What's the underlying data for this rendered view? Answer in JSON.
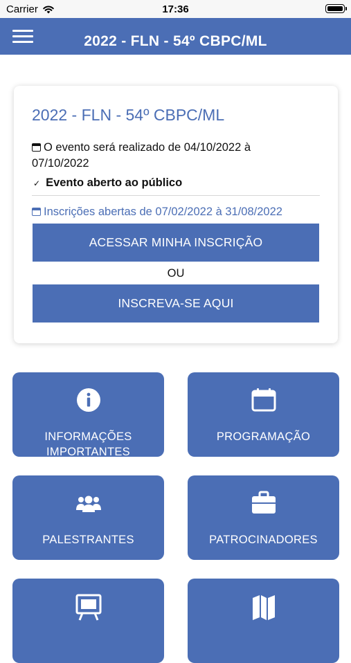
{
  "status_bar": {
    "carrier": "Carrier",
    "time": "17:36"
  },
  "navbar": {
    "title": "2022 - FLN - 54º CBPC/ML",
    "menu_icon": "hamburger-menu-icon"
  },
  "event": {
    "title": "2022 - FLN - 54º CBPC/ML",
    "date_text": "O evento será realizado de 04/10/2022 à 07/10/2022",
    "public_text": "Evento aberto ao público",
    "check_glyph": "✓",
    "registration_text": "Inscrições abertas de 07/02/2022 à 31/08/2022",
    "access_button": "ACESSAR MINHA INSCRIÇÃO",
    "or_text": "OU",
    "signup_button": "INSCREVA-SE AQUI"
  },
  "tiles": [
    {
      "label_1": "INFORMAÇÕES",
      "label_2": "IMPORTANTES",
      "icon": "info-icon"
    },
    {
      "label": "PROGRAMAÇÃO",
      "icon": "calendar-icon"
    },
    {
      "label": "PALESTRANTES",
      "icon": "users-icon"
    },
    {
      "label": "PATROCINADORES",
      "icon": "briefcase-icon"
    },
    {
      "label": "",
      "icon": "easel-icon"
    },
    {
      "label": "",
      "icon": "map-icon"
    }
  ],
  "colors": {
    "primary": "#4b6eb5",
    "text": "#111111",
    "background": "#ffffff"
  }
}
